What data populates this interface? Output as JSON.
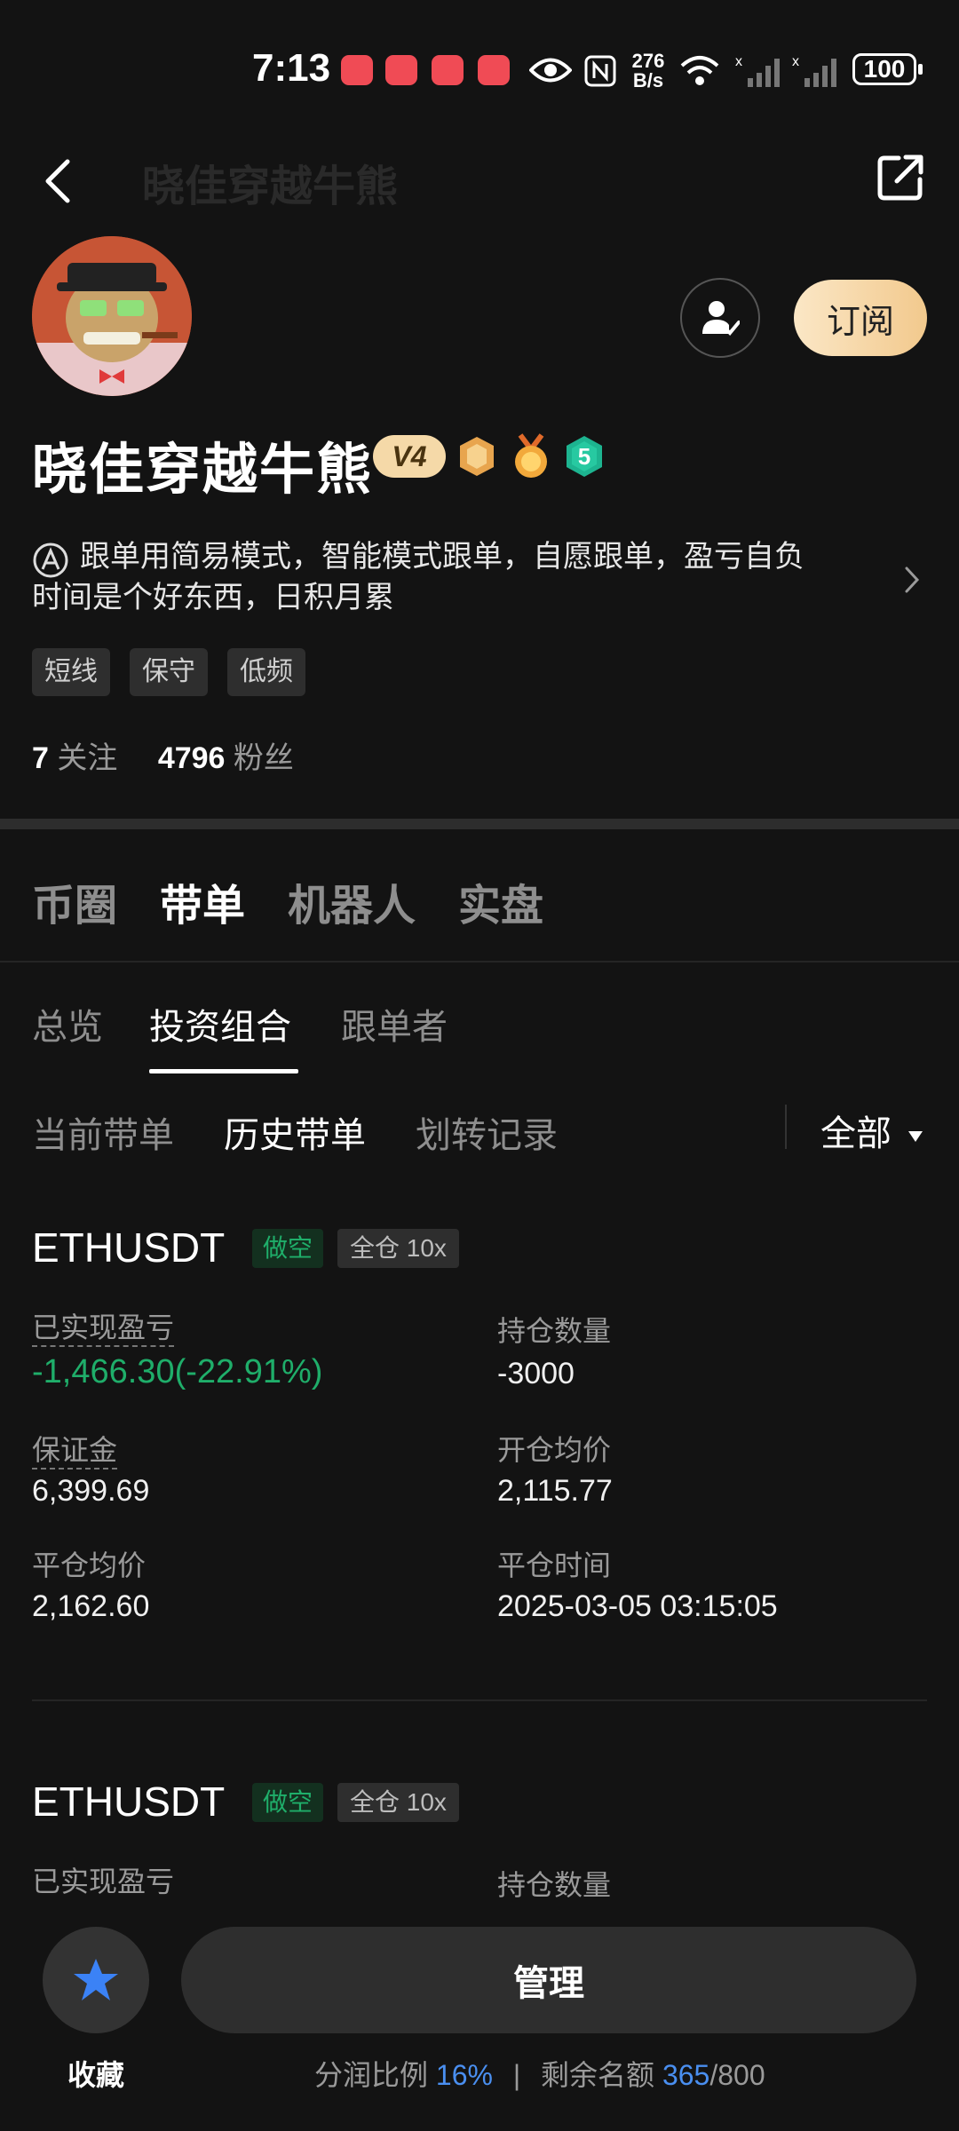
{
  "status_bar": {
    "time": "7:13",
    "speed": "276",
    "speed_unit": "B/s",
    "battery": "100"
  },
  "header": {
    "faded_title": "晓佳穿越牛熊",
    "subscribe_label": "订阅"
  },
  "profile": {
    "name": "晓佳穿越牛熊",
    "level_badge": "V4",
    "rank_badge": "5",
    "bio_line1": "跟单用简易模式，智能模式跟单，自愿跟单，盈亏自负",
    "bio_line2": "时间是个好东西，日积月累",
    "tags": [
      "短线",
      "保守",
      "低频"
    ],
    "following_count": "7",
    "following_label": "关注",
    "followers_count": "4796",
    "followers_label": "粉丝"
  },
  "tabs_primary": [
    "币圈",
    "带单",
    "机器人",
    "实盘"
  ],
  "tabs_secondary": [
    "总览",
    "投资组合",
    "跟单者"
  ],
  "tabs_tertiary": [
    "当前带单",
    "历史带单",
    "划转记录"
  ],
  "filter_label": "全部",
  "positions": [
    {
      "symbol": "ETHUSDT",
      "direction": "做空",
      "leverage": "全仓 10x",
      "realized_pnl_label": "已实现盈亏",
      "realized_pnl": "-1,466.30(-22.91%)",
      "quantity_label": "持仓数量",
      "quantity": "-3000",
      "margin_label": "保证金",
      "margin": "6,399.69",
      "open_avg_label": "开仓均价",
      "open_avg": "2,115.77",
      "close_avg_label": "平仓均价",
      "close_avg": "2,162.60",
      "close_time_label": "平仓时间",
      "close_time": "2025-03-05 03:15:05"
    },
    {
      "symbol": "ETHUSDT",
      "direction": "做空",
      "leverage": "全仓 10x",
      "realized_pnl_label": "已实现盈亏",
      "quantity_label": "持仓数量"
    }
  ],
  "bottom": {
    "favorite_label": "收藏",
    "manage_label": "管理",
    "profit_share_label": "分润比例",
    "profit_share_value": "16%",
    "separator": "|",
    "remaining_label": "剩余名额",
    "remaining_value": "365",
    "remaining_total": "/800"
  },
  "colors": {
    "accent_green": "#1fae6a",
    "accent_blue": "#4a8ff0",
    "subscribe_gold": "#f2c98d"
  },
  "icons": [
    "back-arrow-icon",
    "share-icon",
    "follow-user-icon",
    "star-icon",
    "chevron-right-icon",
    "wifi-icon",
    "eye-icon",
    "nfc-icon"
  ]
}
